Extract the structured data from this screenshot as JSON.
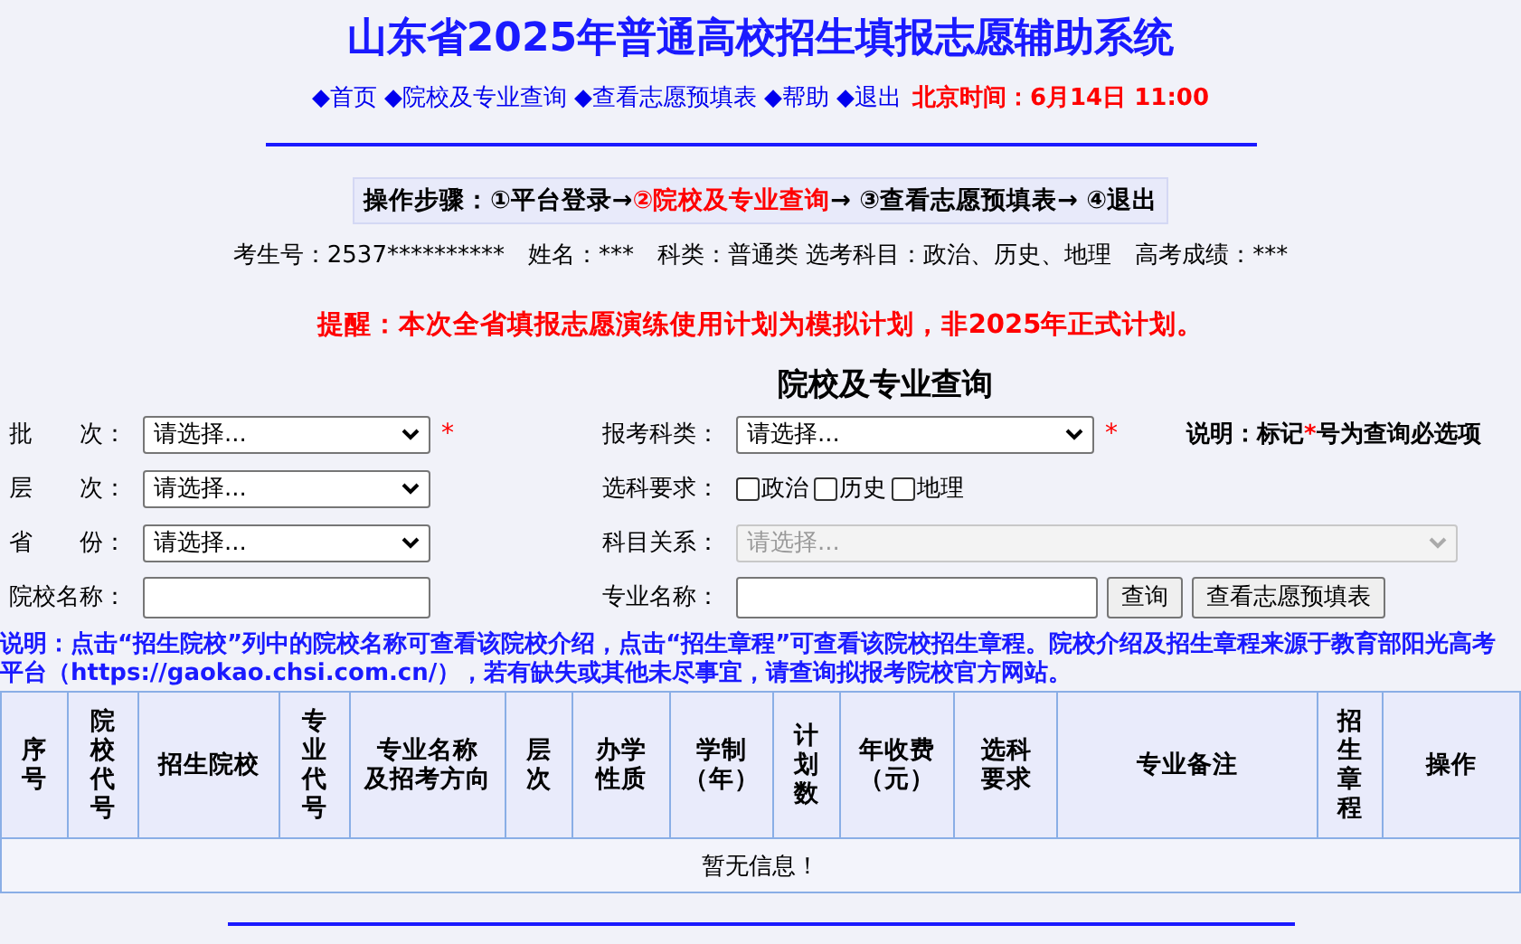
{
  "title": "山东省2025年普通高校招生填报志愿辅助系统",
  "nav": [
    {
      "label": "◆首页"
    },
    {
      "label": "◆院校及专业查询"
    },
    {
      "label": "◆查看志愿预填表"
    },
    {
      "label": "◆帮助"
    },
    {
      "label": "◆退出"
    }
  ],
  "clock": "北京时间：6月14日 11:00",
  "steps": {
    "label": "操作步骤：",
    "items": [
      {
        "text": "①平台登录→",
        "current": false
      },
      {
        "text": "②院校及专业查询",
        "current": true
      },
      {
        "text": "→ ③查看志愿预填表→ ④退出",
        "current": false
      }
    ]
  },
  "candidate": [
    {
      "label": "考生号：",
      "value": "2537**********"
    },
    {
      "label": "姓名：",
      "value": "***"
    },
    {
      "label": "科类：",
      "value": "普通类 选考科目：政治、历史、地理"
    },
    {
      "label": "高考成绩：",
      "value": "***"
    }
  ],
  "reminder": "提醒：本次全省填报志愿演练使用计划为模拟计划，非2025年正式计划。",
  "form_title": "院校及专业查询",
  "form_rows": [
    {
      "left": {
        "label": "批　　次：",
        "kind": "select",
        "value": "请选择...",
        "required": true
      },
      "right": {
        "label": "报考科类：",
        "kind": "select",
        "value": "请选择...",
        "required": true
      },
      "note": {
        "before": "说明：标记",
        "star": "*",
        "after": "号为查询必选项"
      }
    },
    {
      "left": {
        "label": "层　　次：",
        "kind": "select",
        "value": "请选择..."
      },
      "right": {
        "label": "选科要求：",
        "kind": "checks",
        "options": [
          {
            "label": "政治",
            "checked": false
          },
          {
            "label": "历史",
            "checked": false
          },
          {
            "label": "地理",
            "checked": false
          }
        ]
      }
    },
    {
      "left": {
        "label": "省　　份：",
        "kind": "select",
        "value": "请选择..."
      },
      "right": {
        "label": "科目关系：",
        "kind": "select",
        "value": "请选择...",
        "disabled": true
      }
    },
    {
      "left": {
        "label": "院校名称：",
        "kind": "text"
      },
      "right": {
        "label": "专业名称：",
        "kind": "text"
      },
      "buttons": [
        "查询",
        "查看志愿预填表"
      ]
    }
  ],
  "explanation": "说明：点击“招生院校”列中的院校名称可查看该院校介绍，点击“招生章程”可查看该院校招生章程。院校介绍及招生章程来源于教育部阳光高考平台（https://gaokao.chsi.com.cn/），若有缺失或其他未尽事宜，请查询拟报考院校官方网站。",
  "table": {
    "columns": [
      {
        "lines": [
          "序号"
        ]
      },
      {
        "lines": [
          "院校代号"
        ]
      },
      {
        "lines": [
          "招生院校"
        ]
      },
      {
        "lines": [
          "专业代号"
        ]
      },
      {
        "lines": [
          "专业名称",
          "及招考方向"
        ]
      },
      {
        "lines": [
          "层次"
        ]
      },
      {
        "lines": [
          "办学性质"
        ]
      },
      {
        "lines": [
          "学制",
          "（年）"
        ]
      },
      {
        "lines": [
          "计划数"
        ]
      },
      {
        "lines": [
          "年收费",
          "（元）"
        ]
      },
      {
        "lines": [
          "选科",
          "要求"
        ]
      },
      {
        "lines": [
          "专业备注"
        ]
      },
      {
        "lines": [
          "招生章程"
        ]
      },
      {
        "lines": [
          "操作"
        ]
      }
    ],
    "empty": "暂无信息！"
  }
}
